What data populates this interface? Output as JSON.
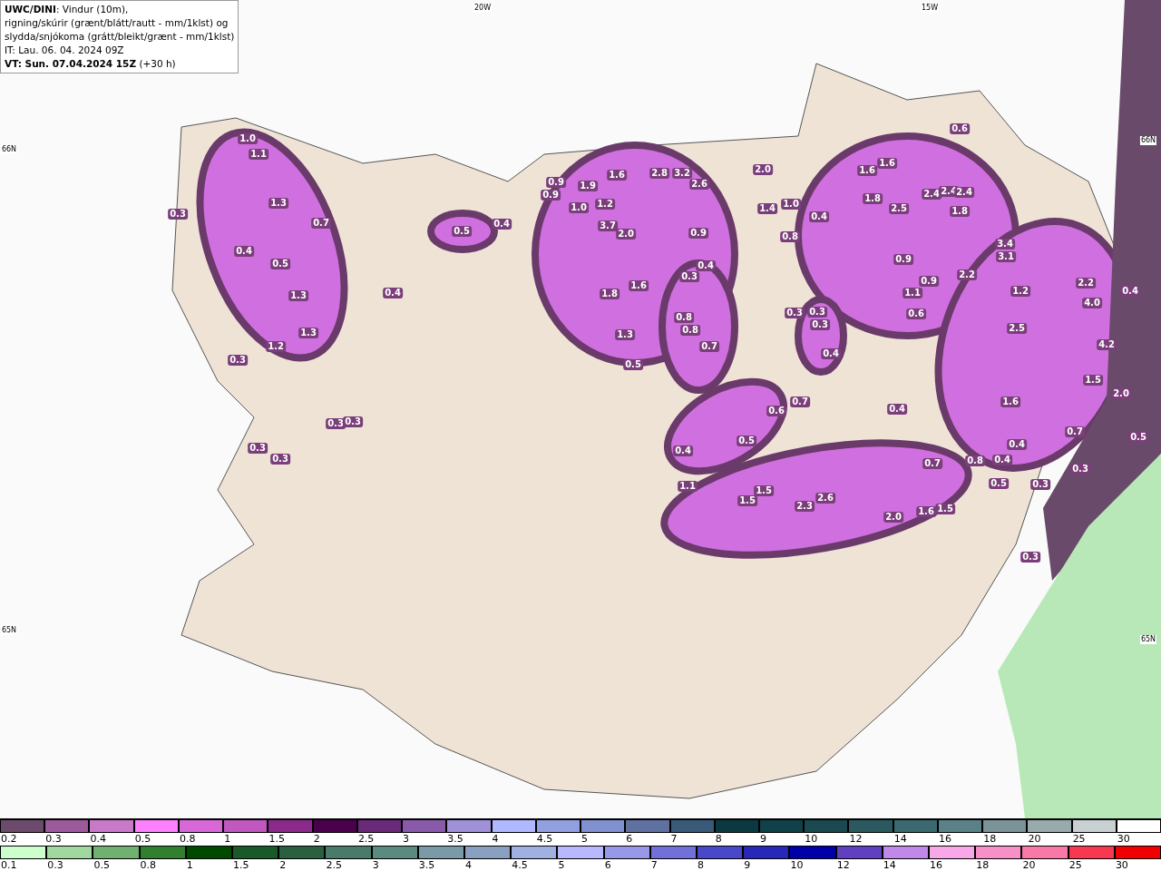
{
  "header": {
    "title": "UWC/DINI",
    "description": ": Vindur (10m),",
    "lines": [
      "rigning/skúrir (grænt/blátt/rautt - mm/1klst) og",
      "slydda/snjókoma (grátt/bleikt/grænt - mm/1klst)",
      "IT: Lau. 06. 04. 2024 09Z"
    ],
    "valid_time": "VT: Sun. 07.04.2024 15Z",
    "lead": "(+30 h)"
  },
  "map": {
    "grid_labels": [
      "20W",
      "15W",
      "66N",
      "65N",
      "66N",
      "65N"
    ],
    "values": [
      "1.0",
      "1.1",
      "0.3",
      "1.3",
      "0.7",
      "0.4",
      "0.5",
      "1.3",
      "1.2",
      "1.3",
      "0.3",
      "0.4",
      "0.5",
      "0.4",
      "0.9",
      "0.9",
      "1.9",
      "1.6",
      "1.0",
      "1.2",
      "3.7",
      "2.0",
      "1.8",
      "1.6",
      "1.3",
      "0.5",
      "2.8",
      "3.2",
      "2.6",
      "0.9",
      "0.4",
      "0.3",
      "2.0",
      "1.4",
      "1.0",
      "0.4",
      "0.8",
      "0.6",
      "1.6",
      "1.6",
      "1.8",
      "2.5",
      "2.4",
      "2.4",
      "2.4",
      "1.8",
      "0.9",
      "0.9",
      "1.1",
      "0.6",
      "2.2",
      "3.4",
      "3.1",
      "1.2",
      "2.5",
      "2.2",
      "4.0",
      "0.4",
      "4.2",
      "1.5",
      "2.0",
      "0.8",
      "0.8",
      "0.7",
      "0.3",
      "0.3",
      "0.3",
      "0.4",
      "0.7",
      "0.6",
      "0.4",
      "0.5",
      "0.4",
      "1.1",
      "1.5",
      "1.5",
      "2.3",
      "2.6",
      "2.0",
      "1.6",
      "1.5",
      "0.7",
      "0.8",
      "0.4",
      "0.4",
      "0.5",
      "1.6",
      "0.7",
      "0.3",
      "0.5",
      "0.3",
      "0.3",
      "0.3",
      "0.3",
      "0.3",
      "0.3"
    ]
  },
  "legend": {
    "precipitation_scale": [
      {
        "label": "0.2",
        "color": "#6b4a6b"
      },
      {
        "label": "0.3",
        "color": "#9b5a9b"
      },
      {
        "label": "0.4",
        "color": "#c87ac8"
      },
      {
        "label": "0.5",
        "color": "#ff80ff"
      },
      {
        "label": "0.8",
        "color": "#d868d8"
      },
      {
        "label": "1",
        "color": "#c058c0"
      },
      {
        "label": "1.5",
        "color": "#8c2a8c"
      },
      {
        "label": "2",
        "color": "#4a004a"
      },
      {
        "label": "2.5",
        "color": "#6a2a7a"
      },
      {
        "label": "3",
        "color": "#8a5aaa"
      },
      {
        "label": "3.5",
        "color": "#a090d8"
      },
      {
        "label": "4",
        "color": "#b0b8ff"
      },
      {
        "label": "4.5",
        "color": "#90a0e0"
      },
      {
        "label": "5",
        "color": "#8090d0"
      },
      {
        "label": "6",
        "color": "#6070a0"
      },
      {
        "label": "7",
        "color": "#3a5a7a"
      },
      {
        "label": "8",
        "color": "#0a3a40"
      },
      {
        "label": "9",
        "color": "#104048"
      },
      {
        "label": "10",
        "color": "#1a4a50"
      },
      {
        "label": "12",
        "color": "#2a5a60"
      },
      {
        "label": "14",
        "color": "#3a6a70"
      },
      {
        "label": "16",
        "color": "#5a8088"
      },
      {
        "label": "18",
        "color": "#7a9298"
      },
      {
        "label": "20",
        "color": "#98aaac"
      },
      {
        "label": "25",
        "color": "#c8d0d2"
      },
      {
        "label": "30",
        "color": "#ffffff"
      }
    ],
    "snow_scale": [
      {
        "label": "0.1",
        "color": "#ccffcc"
      },
      {
        "label": "0.3",
        "color": "#a0d8a0"
      },
      {
        "label": "0.5",
        "color": "#70b070"
      },
      {
        "label": "0.8",
        "color": "#308030"
      },
      {
        "label": "1",
        "color": "#004a00"
      },
      {
        "label": "1.5",
        "color": "#1a5a2a"
      },
      {
        "label": "2",
        "color": "#2a6040"
      },
      {
        "label": "2.5",
        "color": "#4a7a6a"
      },
      {
        "label": "3",
        "color": "#5a8a80"
      },
      {
        "label": "3.5",
        "color": "#7a9aa8"
      },
      {
        "label": "4",
        "color": "#8aa0c0"
      },
      {
        "label": "4.5",
        "color": "#a0b0e0"
      },
      {
        "label": "5",
        "color": "#b8b8ff"
      },
      {
        "label": "6",
        "color": "#9898e8"
      },
      {
        "label": "7",
        "color": "#7070d8"
      },
      {
        "label": "8",
        "color": "#4848c8"
      },
      {
        "label": "9",
        "color": "#2828b8"
      },
      {
        "label": "10",
        "color": "#0000a8"
      },
      {
        "label": "12",
        "color": "#6040c0"
      },
      {
        "label": "14",
        "color": "#c088e8"
      },
      {
        "label": "16",
        "color": "#f8a8e8"
      },
      {
        "label": "18",
        "color": "#f890c8"
      },
      {
        "label": "20",
        "color": "#f878a8"
      },
      {
        "label": "25",
        "color": "#f83850"
      },
      {
        "label": "30",
        "color": "#f00000"
      }
    ]
  }
}
